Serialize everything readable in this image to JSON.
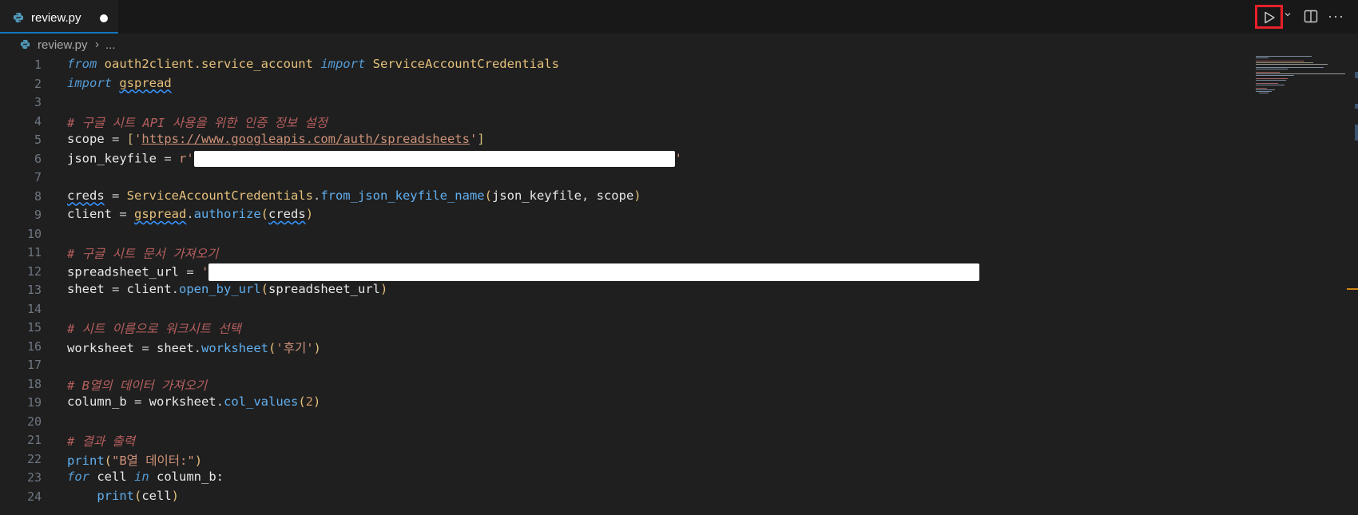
{
  "tab": {
    "filename": "review.py",
    "dirty": true
  },
  "breadcrumb": {
    "file": "review.py",
    "separator": "›",
    "more": "..."
  },
  "actions": {
    "run_icon": "play-icon",
    "split_icon": "split-editor-icon",
    "more_label": "···"
  },
  "code": {
    "line_numbers": [
      "1",
      "2",
      "3",
      "4",
      "5",
      "6",
      "7",
      "8",
      "9",
      "10",
      "11",
      "12",
      "13",
      "14",
      "15",
      "16",
      "17",
      "18",
      "19",
      "20",
      "21",
      "22",
      "23",
      "24"
    ],
    "l1": {
      "kw1": "from",
      "mod": "oauth2client.service_account",
      "kw2": "import",
      "cls": "ServiceAccountCredentials"
    },
    "l2": {
      "kw": "import",
      "mod": "gspread"
    },
    "l4": {
      "comment": "# 구글 시트 API 사용을 위한 인증 정보 설정"
    },
    "l5": {
      "var": "scope",
      "op": " = ",
      "open": "[",
      "q1": "'",
      "url": "https://www.googleapis.com/auth/spreadsheets",
      "q2": "'",
      "close": "]"
    },
    "l6": {
      "var": "json_keyfile",
      "op": " = ",
      "prefix": "r'",
      "suffix": "'"
    },
    "l8": {
      "var": "creds",
      "op": " = ",
      "cls": "ServiceAccountCredentials",
      "dot": ".",
      "fn": "from_json_keyfile_name",
      "open": "(",
      "arg1": "json_keyfile",
      "comma": ", ",
      "arg2": "scope",
      "close": ")"
    },
    "l9": {
      "var": "client",
      "op": " = ",
      "mod": "gspread",
      "dot": ".",
      "fn": "authorize",
      "open": "(",
      "arg": "creds",
      "close": ")"
    },
    "l11": {
      "comment": "# 구글 시트 문서 가져오기"
    },
    "l12": {
      "var": "spreadsheet_url",
      "op": " = ",
      "q": "'"
    },
    "l13": {
      "var": "sheet",
      "op": " = ",
      "obj": "client",
      "dot": ".",
      "fn": "open_by_url",
      "open": "(",
      "arg": "spreadsheet_url",
      "close": ")"
    },
    "l15": {
      "comment": "# 시트 이름으로 워크시트 선택"
    },
    "l16": {
      "var": "worksheet",
      "op": " = ",
      "obj": "sheet",
      "dot": ".",
      "fn": "worksheet",
      "open": "(",
      "str": "'후기'",
      "close": ")"
    },
    "l18": {
      "comment": "# B열의 데이터 가져오기"
    },
    "l19": {
      "var": "column_b",
      "op": " = ",
      "obj": "worksheet",
      "dot": ".",
      "fn": "col_values",
      "open": "(",
      "num": "2",
      "close": ")"
    },
    "l21": {
      "comment": "# 결과 출력"
    },
    "l22": {
      "fn": "print",
      "open": "(",
      "str": "\"B열 데이터:\"",
      "close": ")"
    },
    "l23": {
      "kw1": "for",
      "var": " cell ",
      "kw2": "in",
      "rest": " column_b:"
    },
    "l24": {
      "indent": "    ",
      "fn": "print",
      "open": "(",
      "arg": "cell",
      "close": ")"
    }
  },
  "colors": {
    "background": "#1f1f1f",
    "keyword": "#569cd6",
    "function": "#61afef",
    "string": "#ce9178",
    "comment": "#d16969",
    "class": "#e5c07b",
    "run_highlight": "#e8202a"
  }
}
